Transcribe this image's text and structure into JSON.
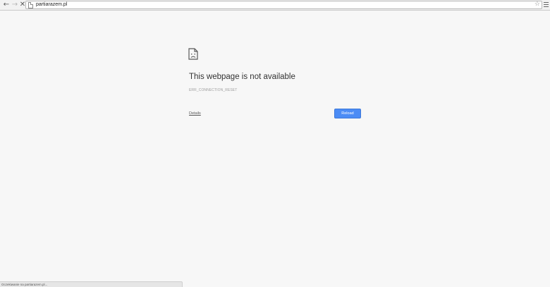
{
  "browser": {
    "url": "partiarazem.pl",
    "icons": {
      "back": "back-arrow-icon",
      "forward": "forward-arrow-icon",
      "stop": "stop-icon",
      "page": "page-icon",
      "bookmark": "star-icon",
      "menu": "hamburger-menu-icon"
    }
  },
  "error_page": {
    "icon": "sad-page-icon",
    "title": "This webpage is not available",
    "error_code": "ERR_CONNECTION_RESET",
    "details_label": "Details",
    "reload_label": "Reload",
    "reload_color": "#4c8cf5"
  },
  "status_bar": {
    "text": "Oczekiwanie na partiarazem.pl..."
  }
}
